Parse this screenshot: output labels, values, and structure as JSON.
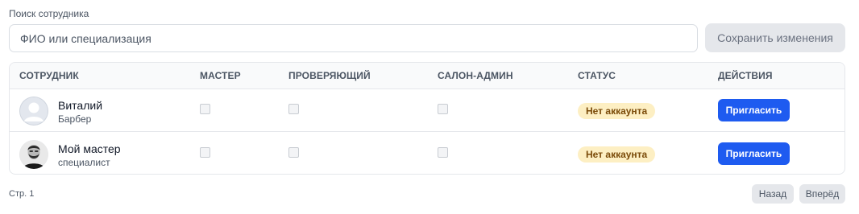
{
  "search": {
    "label": "Поиск сотрудника",
    "placeholder": "ФИО или специализация",
    "value": ""
  },
  "actions": {
    "save_label": "Сохранить изменения"
  },
  "table": {
    "headers": {
      "employee": "СОТРУДНИК",
      "master": "МАСТЕР",
      "reviewer": "ПРОВЕРЯЮЩИЙ",
      "salon_admin": "САЛОН-АДМИН",
      "status": "СТАТУС",
      "actions": "ДЕЙСТВИЯ"
    },
    "rows": [
      {
        "name": "Виталий",
        "role": "Барбер",
        "avatar": "default-user-icon",
        "master": false,
        "reviewer": false,
        "salon_admin": false,
        "status": "Нет аккаунта",
        "action_label": "Пригласить"
      },
      {
        "name": "Мой мастер",
        "role": "специалист",
        "avatar": "photo",
        "master": false,
        "reviewer": false,
        "salon_admin": false,
        "status": "Нет аккаунта",
        "action_label": "Пригласить"
      }
    ]
  },
  "pagination": {
    "page_label": "Стр. 1",
    "prev_label": "Назад",
    "next_label": "Вперёд"
  },
  "colors": {
    "primary": "#1e5bf0",
    "status_badge_bg": "#fdefc3",
    "status_badge_text": "#7a4a08",
    "muted_button_bg": "#e5e7eb"
  }
}
